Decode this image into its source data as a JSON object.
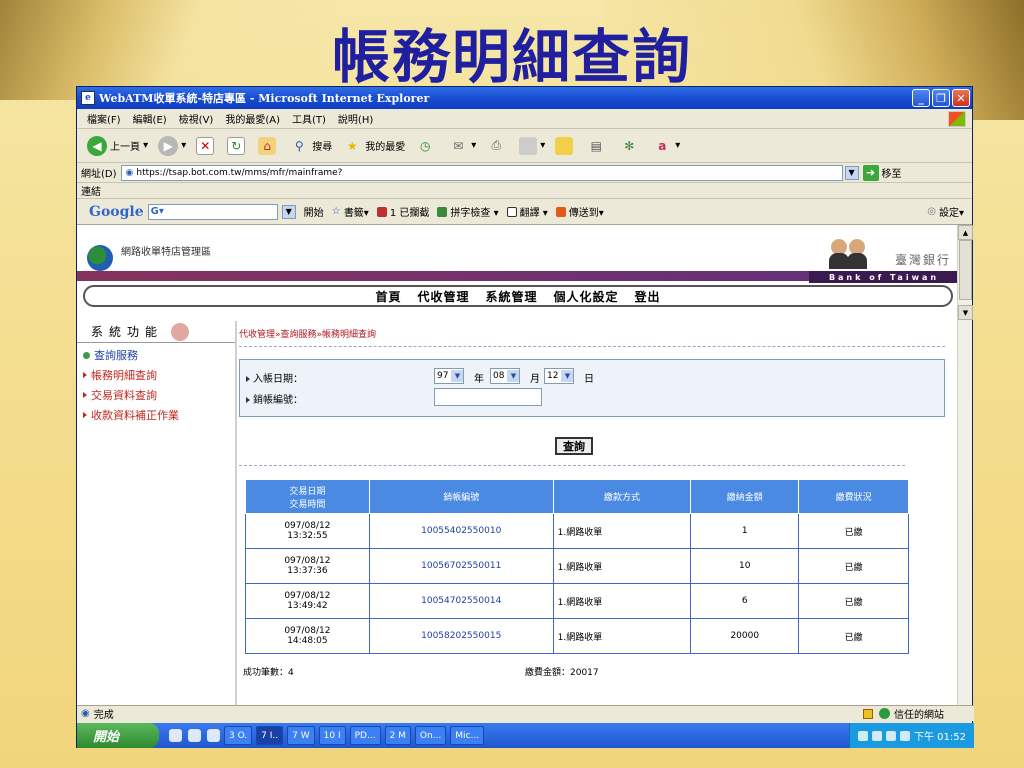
{
  "slide": {
    "title": "帳務明細查詢"
  },
  "window": {
    "title": "WebATM收單系統-特店專區 - Microsoft Internet Explorer"
  },
  "menu": [
    "檔案(F)",
    "編輯(E)",
    "檢視(V)",
    "我的最愛(A)",
    "工具(T)",
    "說明(H)"
  ],
  "toolbar": {
    "back": "上一頁",
    "search": "搜尋",
    "favorites": "我的最愛"
  },
  "address": {
    "label": "網址(D)",
    "url": "https://tsap.bot.com.tw/mms/mfr/mainframe?",
    "go": "移至"
  },
  "links_label": "連結",
  "googlebar": {
    "logo": "Google",
    "field": "G▾",
    "start": "開始",
    "bookmarks": "書籤▾",
    "blocked": "1 已攔截",
    "spell": "拼字檢查 ▾",
    "translate": "翻譯 ▾",
    "sendto": "傳送到▾",
    "settings": "設定▾"
  },
  "site": {
    "logo_text": "網路收單特店管理區",
    "bank_name": "臺灣銀行",
    "bank_en": "Bank of Taiwan",
    "nav": [
      "首頁",
      "代收管理",
      "系統管理",
      "個人化設定",
      "登出"
    ]
  },
  "sidebar": {
    "title": "系統功能",
    "group": "查詢服務",
    "links": [
      "帳務明細查詢",
      "交易資料查詢",
      "收款資料補正作業"
    ]
  },
  "content": {
    "breadcrumb": "代收管理»查詢服務»帳務明細查詢",
    "filter": {
      "date_label": "入帳日期：",
      "year": "97",
      "year_unit": "年",
      "month": "08",
      "month_unit": "月",
      "day": "12",
      "day_unit": "日",
      "account_label": "銷帳編號："
    },
    "query_button": "查詢",
    "table": {
      "headers": [
        "交易日期\n交易時間",
        "銷帳編號",
        "繳款方式",
        "繳納金額",
        "繳費狀況"
      ],
      "rows": [
        {
          "date": "097/08/12",
          "time": "13:32:55",
          "account": "10055402550010",
          "method": "1.網路收單",
          "amount": "1",
          "status": "已繳"
        },
        {
          "date": "097/08/12",
          "time": "13:37:36",
          "account": "10056702550011",
          "method": "1.網路收單",
          "amount": "10",
          "status": "已繳"
        },
        {
          "date": "097/08/12",
          "time": "13:49:42",
          "account": "10054702550014",
          "method": "1.網路收單",
          "amount": "6",
          "status": "已繳"
        },
        {
          "date": "097/08/12",
          "time": "14:48:05",
          "account": "10058202550015",
          "method": "1.網路收單",
          "amount": "20000",
          "status": "已繳"
        }
      ]
    },
    "summary": {
      "count": "成功筆數：4",
      "total": "繳費金額：20017"
    }
  },
  "status": {
    "text": "完成",
    "zone": "信任的網站"
  },
  "taskbar": {
    "start": "開始",
    "tasks": [
      "3 O.",
      "7 I..",
      "7 W",
      "10 I",
      "PD...",
      "2 M",
      "On...",
      "Mic..."
    ],
    "clock": "下午 01:52"
  }
}
